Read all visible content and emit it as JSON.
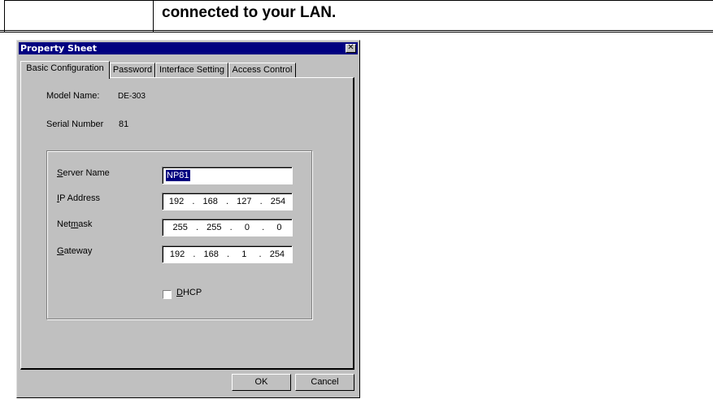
{
  "document": {
    "heading": "connected to your LAN."
  },
  "dialog": {
    "title": "Property Sheet",
    "close_glyph": "✕",
    "tabs": [
      {
        "label": "Basic Configuration",
        "active": true
      },
      {
        "label": "Password",
        "active": false
      },
      {
        "label": "Interface Setting",
        "active": false
      },
      {
        "label": "Access Control",
        "active": false
      }
    ],
    "model_name_label": "Model Name:",
    "model_name_value": "DE-303",
    "serial_label": "Serial Number",
    "serial_value": "81",
    "fields": {
      "server_name": {
        "label_prefix": "S",
        "label_rest": "erver Name",
        "value": "NP81"
      },
      "ip_address": {
        "label_prefix": "I",
        "label_rest": "P Address",
        "value": "192  .  168  .  127  .  254"
      },
      "netmask": {
        "label_start": "Net",
        "label_mnemonic": "m",
        "label_rest": "ask",
        "value": "255  .  255  .   0   .   0"
      },
      "gateway": {
        "label_prefix": "G",
        "label_rest": "ateway",
        "value": "192  .  168  .   1   .  254"
      }
    },
    "dhcp": {
      "label_prefix": "D",
      "label_rest": "HCP",
      "checked": false
    },
    "buttons": {
      "ok": "OK",
      "cancel": "Cancel"
    }
  }
}
